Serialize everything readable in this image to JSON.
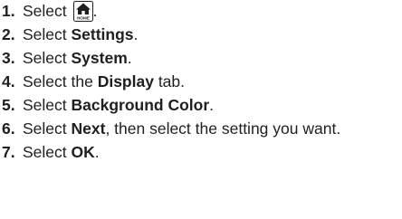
{
  "steps": [
    {
      "num": "1.",
      "pre": "Select",
      "icon": "home-icon",
      "icon_label": "HOME",
      "post": "."
    },
    {
      "num": "2.",
      "pre": "Select ",
      "bold": "Settings",
      "post": "."
    },
    {
      "num": "3.",
      "pre": "Select ",
      "bold": "System",
      "post": "."
    },
    {
      "num": "4.",
      "pre": "Select the ",
      "bold": "Display",
      "post": " tab."
    },
    {
      "num": "5.",
      "pre": "Select ",
      "bold": "Background Color",
      "post": "."
    },
    {
      "num": "6.",
      "pre": "Select ",
      "bold": "Next",
      "post": ", then select the setting you want."
    },
    {
      "num": "7.",
      "pre": "Select ",
      "bold": "OK",
      "post": "."
    }
  ]
}
